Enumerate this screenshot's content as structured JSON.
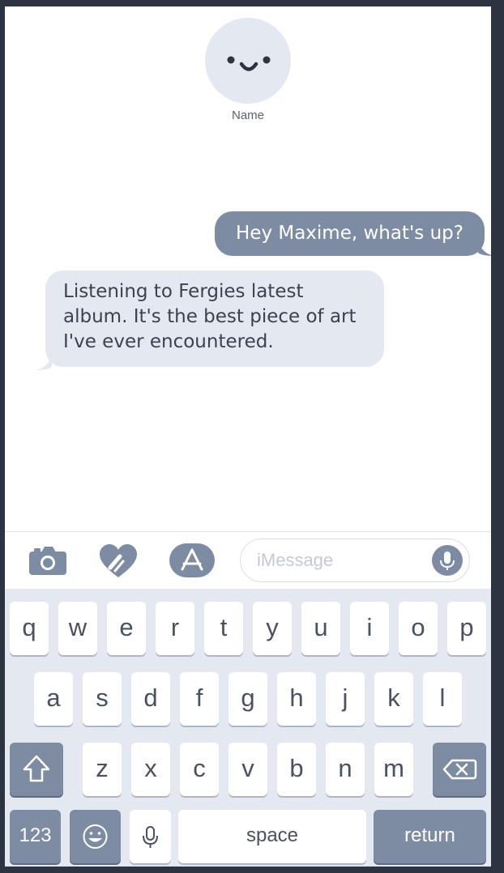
{
  "contact": {
    "name": "Name"
  },
  "messages": {
    "outgoing": "Hey Maxime, what's up?",
    "incoming_lines": [
      "Listening to Fergies latest",
      "album. It's the best piece of art",
      "I've ever encountered."
    ]
  },
  "input": {
    "placeholder": "iMessage"
  },
  "keyboard": {
    "row1": [
      "q",
      "w",
      "e",
      "r",
      "t",
      "y",
      "u",
      "i",
      "o",
      "p"
    ],
    "row2": [
      "a",
      "s",
      "d",
      "f",
      "g",
      "h",
      "j",
      "k",
      "l"
    ],
    "row3": [
      "z",
      "x",
      "c",
      "v",
      "b",
      "n",
      "m"
    ],
    "numbers_label": "123",
    "space_label": "space",
    "return_label": "return"
  },
  "icons": {
    "shift": "shift-icon",
    "backspace": "backspace-icon",
    "emoji": "emoji-icon",
    "dictation": "microphone-icon",
    "camera": "camera-icon",
    "digital_touch": "heart-icon",
    "app_store": "app-store-icon"
  },
  "colors": {
    "accent": "#7e8ca3",
    "bubble_incoming": "#e3e8f1",
    "keyboard_bg": "#e3e8f1"
  }
}
